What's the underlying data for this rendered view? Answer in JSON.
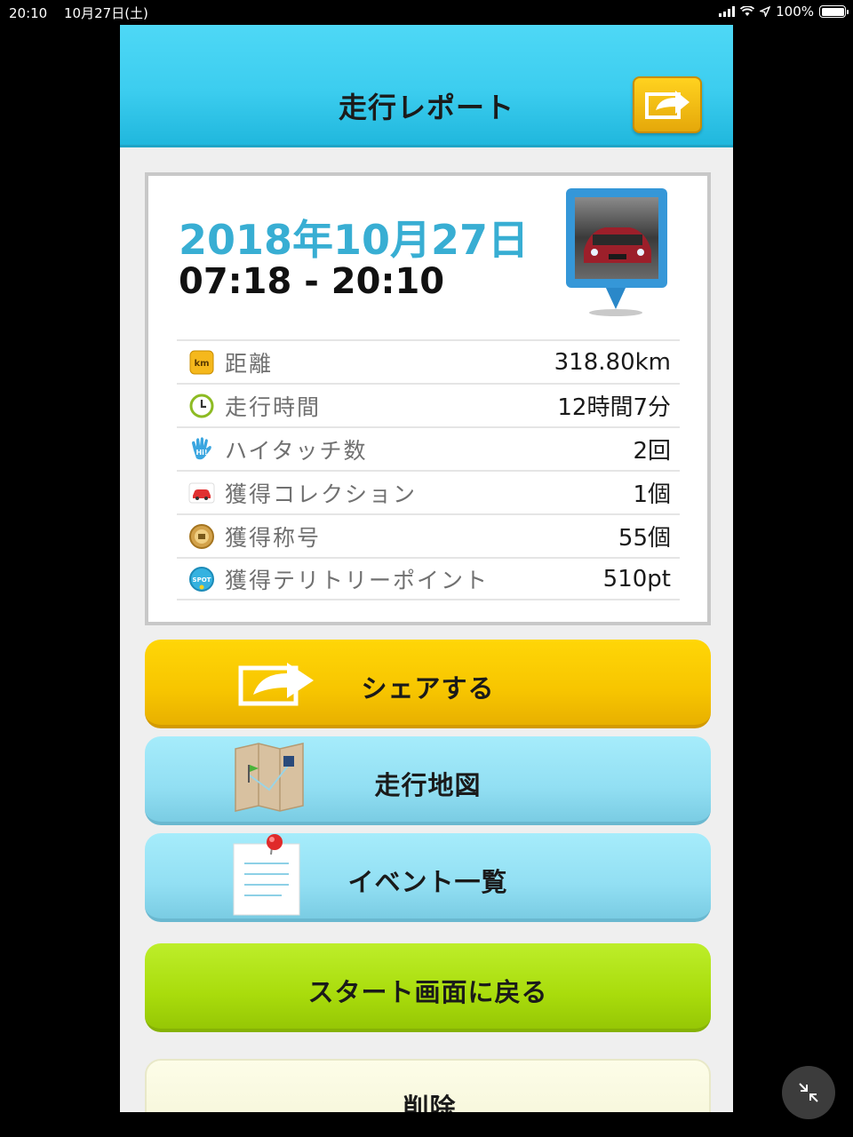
{
  "status_bar": {
    "time": "20:10",
    "date": "10月27日(土)",
    "battery": "100%"
  },
  "header": {
    "title": "走行レポート"
  },
  "report": {
    "date": "2018年10月27日",
    "time_range": "07:18 - 20:10",
    "rows": [
      {
        "icon": "km-icon",
        "label": "距離",
        "value": "318.80km"
      },
      {
        "icon": "clock-icon",
        "label": "走行時間",
        "value": "12時間7分"
      },
      {
        "icon": "hi-touch-icon",
        "label": "ハイタッチ数",
        "value": "2回"
      },
      {
        "icon": "car-collection-icon",
        "label": "獲得コレクション",
        "value": "1個"
      },
      {
        "icon": "title-medal-icon",
        "label": "獲得称号",
        "value": "55個"
      },
      {
        "icon": "spot-icon",
        "label": "獲得テリトリーポイント",
        "value": "510pt"
      }
    ]
  },
  "buttons": {
    "share": "シェアする",
    "map": "走行地図",
    "events": "イベント一覧",
    "back_to_start": "スタート画面に戻る",
    "delete": "削除"
  },
  "colors": {
    "header": "#3ccdef",
    "date": "#38aed3",
    "share_button": "#f7c500",
    "blue_button": "#92dff3",
    "green_button": "#a9dc0c"
  }
}
